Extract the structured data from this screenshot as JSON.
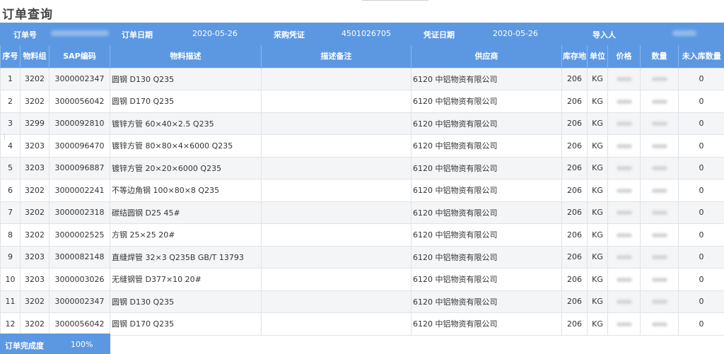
{
  "title": "订单查询",
  "info": {
    "order_no_label": "订单号",
    "order_no_value": "",
    "order_date_label": "订单日期",
    "order_date_value": "2020-05-26",
    "po_label": "采购凭证",
    "po_value": "4501026705",
    "voucher_date_label": "凭证日期",
    "voucher_date_value": "2020-05-26",
    "importer_label": "导入人",
    "importer_value": ""
  },
  "columns": [
    "序号",
    "物料组",
    "SAP编码",
    "物料描述",
    "描述备注",
    "供应商",
    "库存地",
    "单位",
    "价格",
    "数量",
    "未入库数量"
  ],
  "rows": [
    {
      "seq": "1",
      "group": "3202",
      "sap": "3000002347",
      "desc": "圆钢 D130 Q235",
      "note": "",
      "supplier": "6120 中铝物资有限公司",
      "loc": "206",
      "unit": "KG",
      "remain": "0"
    },
    {
      "seq": "2",
      "group": "3202",
      "sap": "3000056042",
      "desc": "圆钢 D170 Q235",
      "note": "",
      "supplier": "6120 中铝物资有限公司",
      "loc": "206",
      "unit": "KG",
      "remain": "0"
    },
    {
      "seq": "3",
      "group": "3299",
      "sap": "3000092810",
      "desc": "镀锌方管 60×40×2.5 Q235",
      "note": "",
      "supplier": "6120 中铝物资有限公司",
      "loc": "206",
      "unit": "KG",
      "remain": "0"
    },
    {
      "seq": "4",
      "group": "3203",
      "sap": "3000096470",
      "desc": "镀锌方管 80×80×4×6000 Q235",
      "note": "",
      "supplier": "6120 中铝物资有限公司",
      "loc": "206",
      "unit": "KG",
      "remain": "0"
    },
    {
      "seq": "5",
      "group": "3203",
      "sap": "3000096887",
      "desc": "镀锌方管 20×20×6000 Q235",
      "note": "",
      "supplier": "6120 中铝物资有限公司",
      "loc": "206",
      "unit": "KG",
      "remain": "0"
    },
    {
      "seq": "6",
      "group": "3202",
      "sap": "3000002241",
      "desc": "不等边角钢 100×80×8 Q235",
      "note": "",
      "supplier": "6120 中铝物资有限公司",
      "loc": "206",
      "unit": "KG",
      "remain": "0"
    },
    {
      "seq": "7",
      "group": "3202",
      "sap": "3000002318",
      "desc": "碳结圆钢 D25 45#",
      "note": "",
      "supplier": "6120 中铝物资有限公司",
      "loc": "206",
      "unit": "KG",
      "remain": "0"
    },
    {
      "seq": "8",
      "group": "3202",
      "sap": "3000002525",
      "desc": "方钢 25×25 20#",
      "note": "",
      "supplier": "6120 中铝物资有限公司",
      "loc": "206",
      "unit": "KG",
      "remain": "0"
    },
    {
      "seq": "9",
      "group": "3203",
      "sap": "3000082148",
      "desc": "直缝焊管 32×3 Q235B GB/T 13793",
      "note": "",
      "supplier": "6120 中铝物资有限公司",
      "loc": "206",
      "unit": "KG",
      "remain": "0"
    },
    {
      "seq": "10",
      "group": "3203",
      "sap": "3000003026",
      "desc": "无缝钢管 D377×10 20#",
      "note": "",
      "supplier": "6120 中铝物资有限公司",
      "loc": "206",
      "unit": "KG",
      "remain": "0"
    },
    {
      "seq": "11",
      "group": "3202",
      "sap": "3000002347",
      "desc": "圆钢 D130 Q235",
      "note": "",
      "supplier": "6120 中铝物资有限公司",
      "loc": "206",
      "unit": "KG",
      "remain": "0"
    },
    {
      "seq": "12",
      "group": "3202",
      "sap": "3000056042",
      "desc": "圆钢 D170 Q235",
      "note": "",
      "supplier": "6120 中铝物资有限公司",
      "loc": "206",
      "unit": "KG",
      "remain": "0"
    }
  ],
  "footer": {
    "completion_label": "订单完成度",
    "completion_value": "100%"
  },
  "colors": {
    "header_blue": "#5c98e2",
    "row_alt": "#f4f5f7"
  }
}
